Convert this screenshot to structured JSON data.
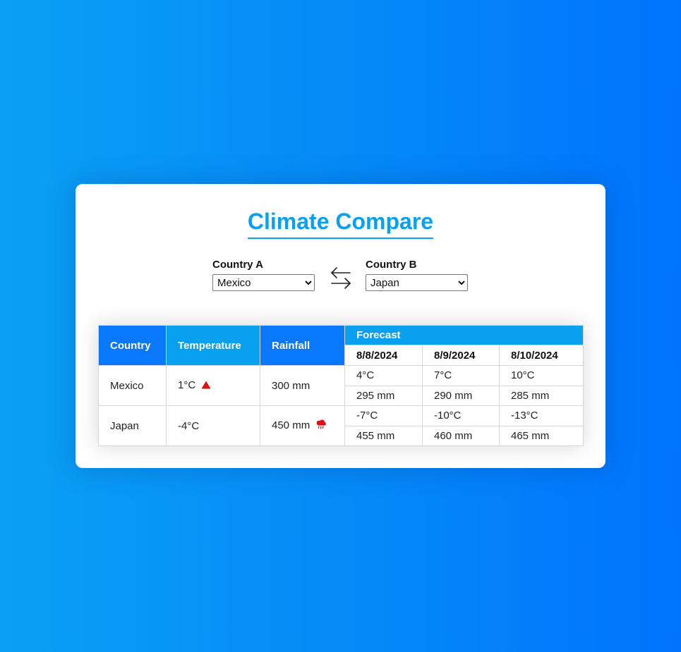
{
  "title": "Climate Compare",
  "country_a": {
    "label": "Country A",
    "selected": "Mexico",
    "options": [
      "Mexico"
    ]
  },
  "country_b": {
    "label": "Country B",
    "selected": "Japan",
    "options": [
      "Japan"
    ]
  },
  "table": {
    "headers": {
      "country": "Country",
      "temperature": "Temperature",
      "rainfall": "Rainfall",
      "forecast": "Forecast"
    },
    "forecast_dates": [
      "8/8/2024",
      "8/9/2024",
      "8/10/2024"
    ],
    "rows": [
      {
        "country": "Mexico",
        "temperature": "1°C",
        "temperature_icon": "warning-triangle-icon",
        "rainfall": "300 mm",
        "forecast_temps": [
          "4°C",
          "7°C",
          "10°C"
        ],
        "forecast_rain": [
          "295 mm",
          "290 mm",
          "285 mm"
        ]
      },
      {
        "country": "Japan",
        "temperature": "-4°C",
        "rainfall": "450 mm",
        "rainfall_icon": "rain-cloud-icon",
        "forecast_temps": [
          "-7°C",
          "-10°C",
          "-13°C"
        ],
        "forecast_rain": [
          "455 mm",
          "460 mm",
          "465 mm"
        ]
      }
    ]
  },
  "icons": {
    "swap": "swap-arrows-icon"
  },
  "colors": {
    "accent": "#0aa0f0",
    "header_blue": "#0a78fb",
    "alert_red": "#e01010"
  }
}
